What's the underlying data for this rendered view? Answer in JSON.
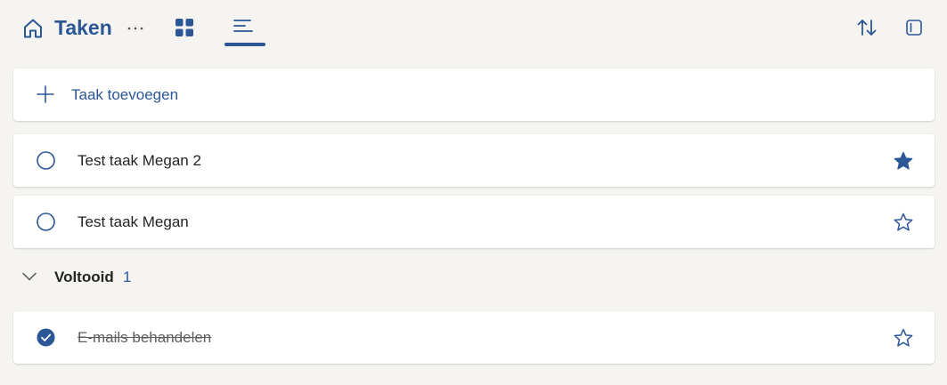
{
  "app": {
    "title": "Taken"
  },
  "colors": {
    "accent": "#2b5797",
    "background": "#f5f4f1",
    "card": "#ffffff"
  },
  "header": {
    "icons": [
      "home-icon",
      "more-icon",
      "grid-view-icon",
      "list-view-icon",
      "sort-icon",
      "details-pane-icon"
    ],
    "active_view": "list"
  },
  "add_task": {
    "label": "Taak toevoegen",
    "icon": "plus-icon"
  },
  "tasks": [
    {
      "title": "Test taak Megan 2",
      "completed": false,
      "important": true
    },
    {
      "title": "Test taak Megan",
      "completed": false,
      "important": false
    }
  ],
  "completed_section": {
    "label": "Voltooid",
    "count": "1",
    "expanded": true,
    "tasks": [
      {
        "title": "E-mails behandelen",
        "completed": true,
        "important": false
      }
    ]
  }
}
